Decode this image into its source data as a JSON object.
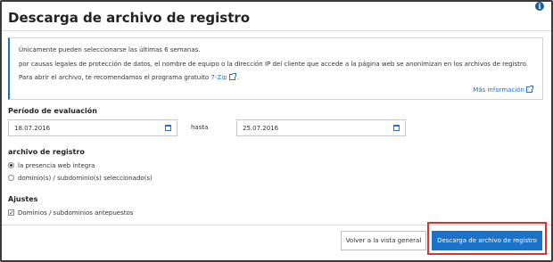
{
  "header": {
    "title": "Descarga de archivo de registro",
    "info_icon": "i"
  },
  "notice": {
    "line1": "Únicamente pueden seleccionarse las últimas 6 semanas.",
    "line2": "por causas legales de protección de datos, el nombre de equipo o la dirección IP del cliente que accede a la página web se anonimizan en los archivos de registro.",
    "line3_prefix": "Para abrir el archivo, te recomendamos el programa gratuito",
    "line3_link": "7-Zip",
    "line3_suffix": ".",
    "more_link": "Más información"
  },
  "period": {
    "label": "Período de evaluación",
    "from_value": "18.07.2016",
    "separator": "hasta",
    "to_value": "25.07.2016"
  },
  "logfile": {
    "label": "archivo de registro",
    "options": [
      {
        "label": "la presencia web íntegra",
        "selected": true
      },
      {
        "label": "dominio(s) / subdominio(s) seleccionado(s)",
        "selected": false
      }
    ]
  },
  "settings": {
    "label": "Ajustes",
    "checkbox_label": "Dominios / subdominios antepuestos",
    "checked": true
  },
  "footer": {
    "back_label": "Volver a la vista general",
    "download_label": "Descarga de archivo de registro"
  },
  "colors": {
    "accent": "#1c72c8",
    "highlight": "#d93232"
  }
}
